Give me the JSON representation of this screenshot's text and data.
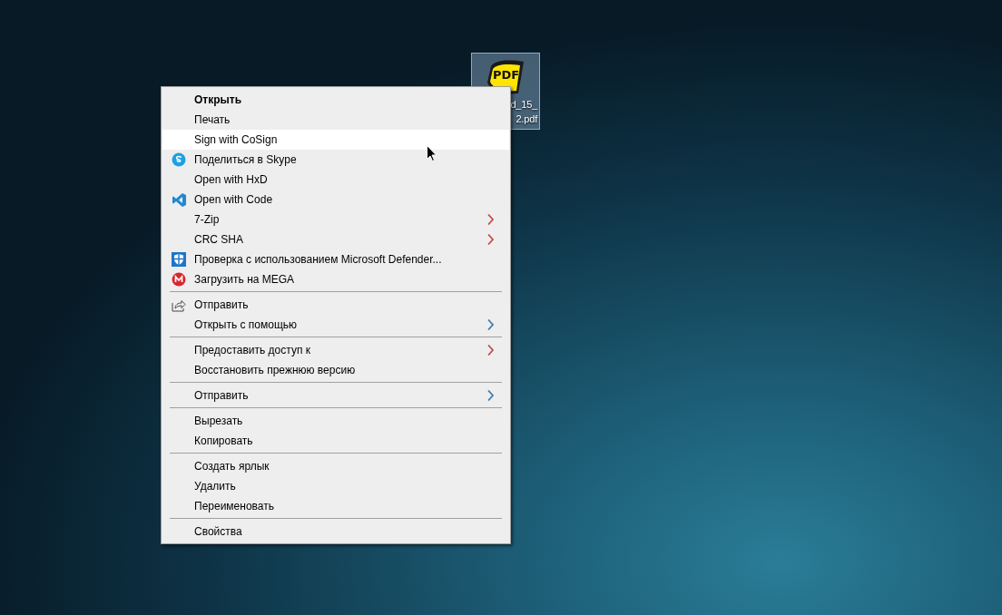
{
  "desktop_icon": {
    "logo_text": "PDF",
    "label_lines": [
      "d_15_",
      "2.pdf"
    ],
    "selected": true
  },
  "context_menu": {
    "sections": [
      {
        "items": [
          {
            "label": "Открыть",
            "bold": true,
            "selected": false,
            "kind": "plain"
          },
          {
            "label": "Печать",
            "bold": false,
            "selected": false,
            "kind": "plain"
          },
          {
            "label": "Sign with CoSign",
            "bold": false,
            "selected": true,
            "kind": "plain"
          },
          {
            "label": "Поделиться в Skype",
            "bold": false,
            "selected": false,
            "kind": "skype"
          },
          {
            "label": "Open with HxD",
            "bold": false,
            "selected": false,
            "kind": "plain"
          },
          {
            "label": "Open with Code",
            "bold": false,
            "selected": false,
            "kind": "code"
          },
          {
            "label": "7-Zip",
            "bold": false,
            "selected": false,
            "kind": "submenu",
            "color": "#c0504d"
          },
          {
            "label": "CRC SHA",
            "bold": false,
            "selected": false,
            "kind": "submenu",
            "color": "#c0504d"
          },
          {
            "label": "Проверка с использованием Microsoft Defender...",
            "bold": false,
            "selected": false,
            "kind": "defender"
          },
          {
            "label": "Загрузить на MEGA",
            "bold": false,
            "selected": false,
            "kind": "mega"
          }
        ]
      },
      {
        "items": [
          {
            "label": "Отправить",
            "bold": false,
            "selected": false,
            "kind": "share"
          },
          {
            "label": "Открыть с помощью",
            "bold": false,
            "selected": false,
            "kind": "submenu",
            "color": "#3c7fb1"
          }
        ]
      },
      {
        "items": [
          {
            "label": "Предоставить доступ к",
            "bold": false,
            "selected": false,
            "kind": "submenu",
            "color": "#c0504d"
          },
          {
            "label": "Восстановить прежнюю версию",
            "bold": false,
            "selected": false,
            "kind": "plain"
          }
        ]
      },
      {
        "items": [
          {
            "label": "Отправить",
            "bold": false,
            "selected": false,
            "kind": "submenu",
            "color": "#3c7fb1"
          }
        ]
      },
      {
        "items": [
          {
            "label": "Вырезать",
            "bold": false,
            "selected": false,
            "kind": "plain"
          },
          {
            "label": "Копировать",
            "bold": false,
            "selected": false,
            "kind": "plain"
          }
        ]
      },
      {
        "items": [
          {
            "label": "Создать ярлык",
            "bold": false,
            "selected": false,
            "kind": "plain"
          },
          {
            "label": "Удалить",
            "bold": false,
            "selected": false,
            "kind": "plain"
          },
          {
            "label": "Переименовать",
            "bold": false,
            "selected": false,
            "kind": "plain"
          }
        ]
      },
      {
        "items": [
          {
            "label": "Свойства",
            "bold": false,
            "selected": false,
            "kind": "plain"
          }
        ]
      }
    ]
  }
}
